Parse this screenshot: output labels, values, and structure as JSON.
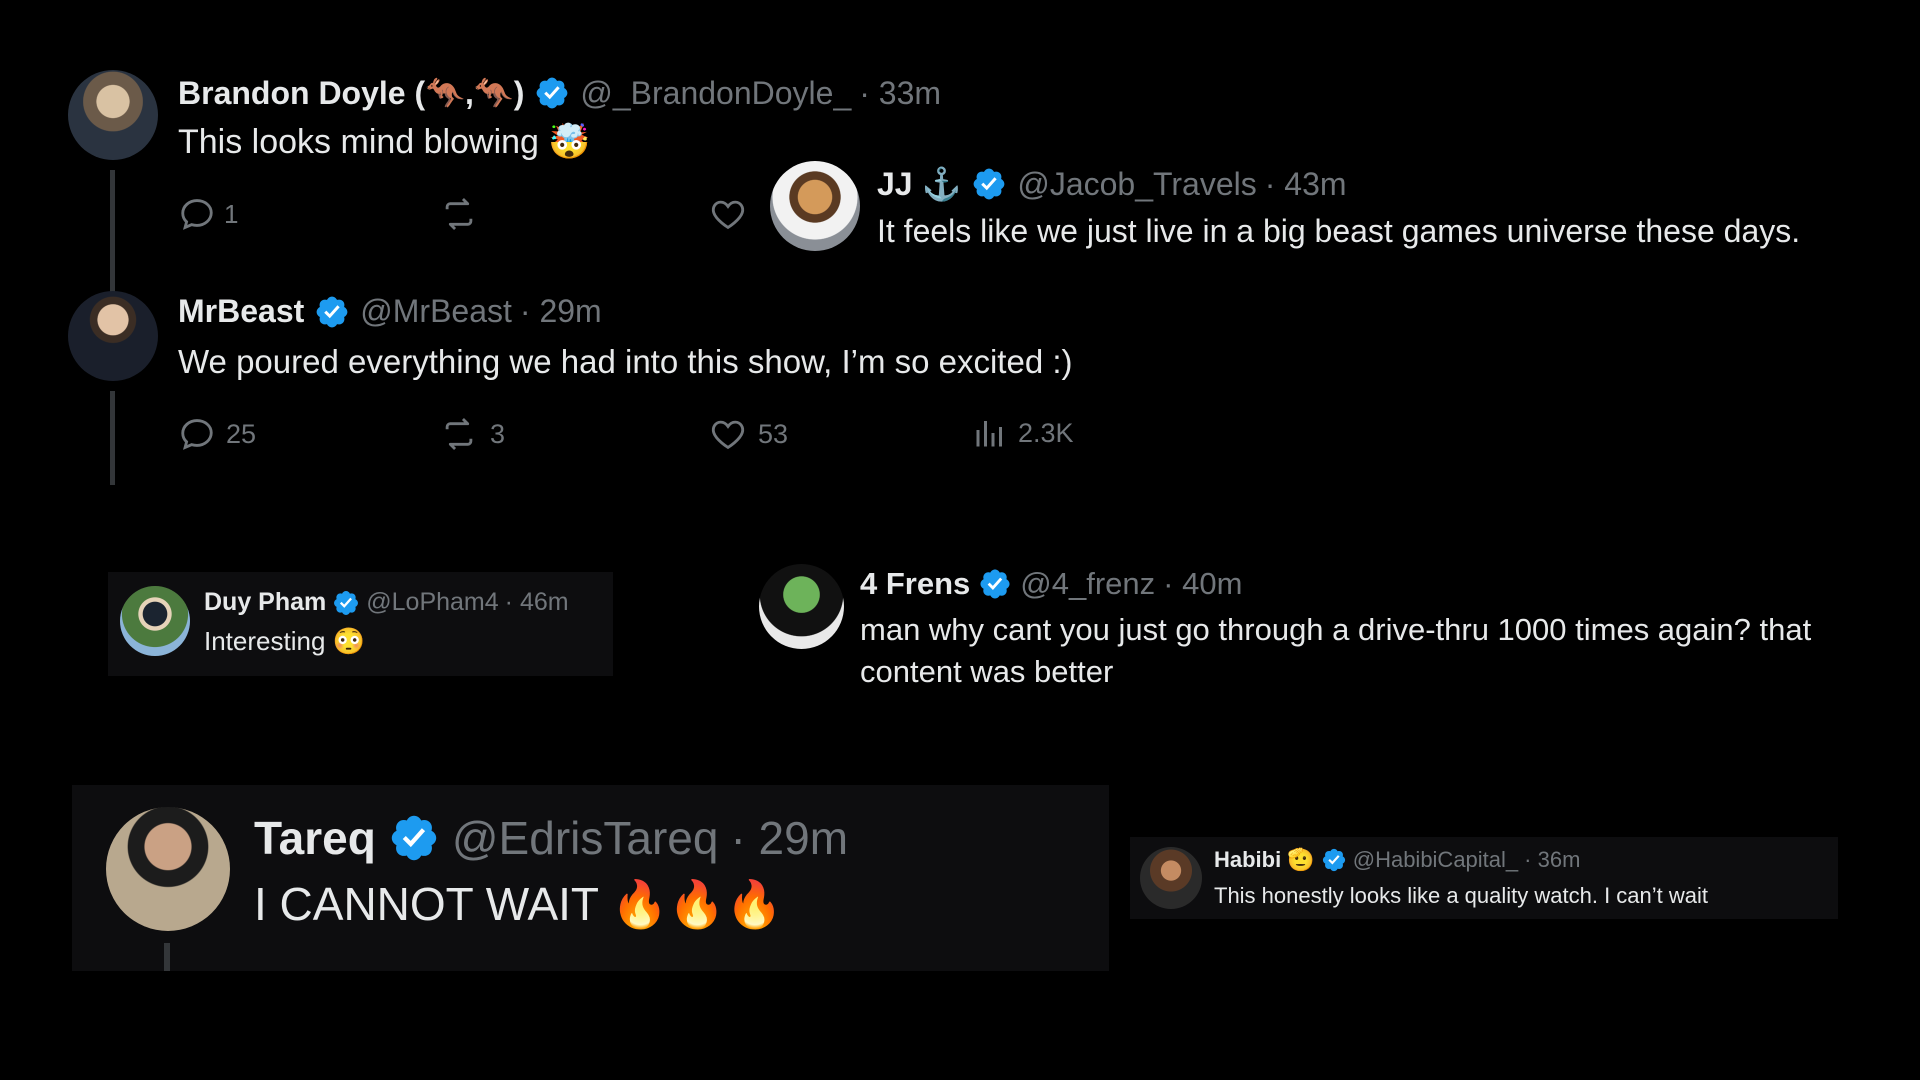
{
  "accent": "#1d9bf0",
  "posts": {
    "brandon": {
      "name": "Brandon Doyle (🦘,🦘)",
      "handle": "@_BrandonDoyle_",
      "time": "· 33m",
      "text": "This looks mind blowing",
      "emoji": "🤯",
      "stats": {
        "replies": "1",
        "reposts": "",
        "likes": ""
      }
    },
    "jj": {
      "name": "JJ ⚓",
      "handle": "@Jacob_Travels",
      "time": "· 43m",
      "text": "It feels like we just live in a big beast games universe these days."
    },
    "mrbeast": {
      "name": "MrBeast",
      "handle": "@MrBeast",
      "time": "· 29m",
      "text": "We poured everything we had into this show, I’m so excited :)",
      "stats": {
        "replies": "25",
        "reposts": "3",
        "likes": "53",
        "views": "2.3K"
      }
    },
    "duy": {
      "name": "Duy Pham",
      "handle": "@LoPham4",
      "time": "· 46m",
      "text": "Interesting",
      "emoji": "😳"
    },
    "frens": {
      "name": "4 Frens",
      "handle": "@4_frenz",
      "time": "· 40m",
      "text_line1": "man why cant you just go through a drive-thru 1000 times again? that",
      "text_line2": "content was better"
    },
    "tareq": {
      "name": "Tareq",
      "handle": "@EdrisTareq",
      "time": "· 29m",
      "text": "I CANNOT WAIT",
      "emoji": "🔥🔥🔥"
    },
    "habibi": {
      "name": "Habibi 🫡",
      "handle": "@HabibiCapital_",
      "time": "· 36m",
      "text": "This honestly looks like a quality watch. I can’t wait"
    }
  },
  "icons": {
    "reply": "reply-icon",
    "repost": "repost-icon",
    "like": "heart-icon",
    "views": "views-icon",
    "verified": "verified-badge-icon"
  }
}
